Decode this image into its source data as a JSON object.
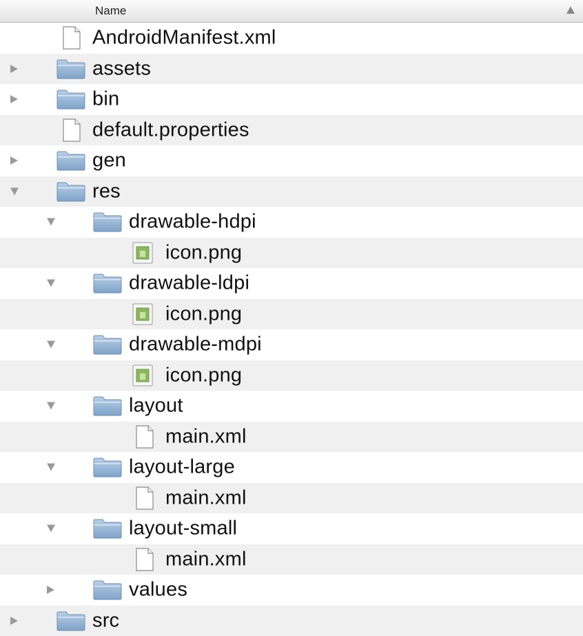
{
  "header": {
    "name_label": "Name"
  },
  "rows": [
    {
      "label": "AndroidManifest.xml",
      "type": "file",
      "level": 0,
      "state": "none"
    },
    {
      "label": "assets",
      "type": "folder",
      "level": 0,
      "state": "collapsed"
    },
    {
      "label": "bin",
      "type": "folder",
      "level": 0,
      "state": "collapsed"
    },
    {
      "label": "default.properties",
      "type": "file",
      "level": 0,
      "state": "none"
    },
    {
      "label": "gen",
      "type": "folder",
      "level": 0,
      "state": "collapsed"
    },
    {
      "label": "res",
      "type": "folder",
      "level": 0,
      "state": "expanded"
    },
    {
      "label": "drawable-hdpi",
      "type": "folder",
      "level": 1,
      "state": "expanded"
    },
    {
      "label": "icon.png",
      "type": "image",
      "level": 2,
      "state": "none"
    },
    {
      "label": "drawable-ldpi",
      "type": "folder",
      "level": 1,
      "state": "expanded"
    },
    {
      "label": "icon.png",
      "type": "image",
      "level": 2,
      "state": "none"
    },
    {
      "label": "drawable-mdpi",
      "type": "folder",
      "level": 1,
      "state": "expanded"
    },
    {
      "label": "icon.png",
      "type": "image",
      "level": 2,
      "state": "none"
    },
    {
      "label": "layout",
      "type": "folder",
      "level": 1,
      "state": "expanded"
    },
    {
      "label": "main.xml",
      "type": "file",
      "level": 2,
      "state": "none"
    },
    {
      "label": "layout-large",
      "type": "folder",
      "level": 1,
      "state": "expanded"
    },
    {
      "label": "main.xml",
      "type": "file",
      "level": 2,
      "state": "none"
    },
    {
      "label": "layout-small",
      "type": "folder",
      "level": 1,
      "state": "expanded"
    },
    {
      "label": "main.xml",
      "type": "file",
      "level": 2,
      "state": "none"
    },
    {
      "label": "values",
      "type": "folder",
      "level": 1,
      "state": "collapsed"
    },
    {
      "label": "src",
      "type": "folder",
      "level": 0,
      "state": "collapsed"
    }
  ]
}
